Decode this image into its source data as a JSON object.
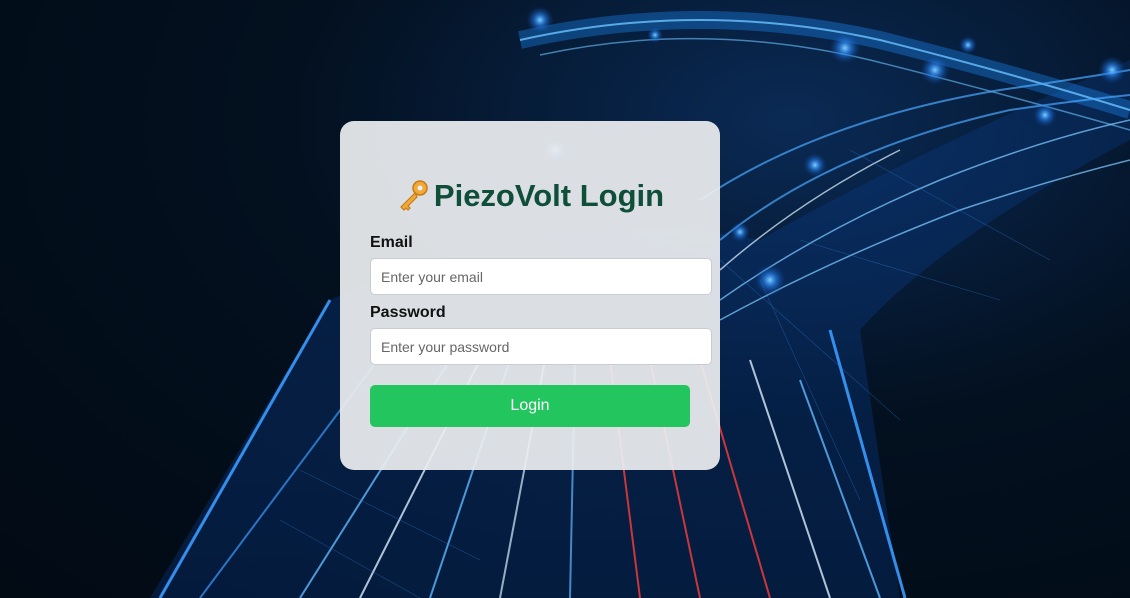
{
  "login": {
    "title": "PiezoVolt Login",
    "icon": "key-icon",
    "email_label": "Email",
    "email_placeholder": "Enter your email",
    "email_value": "",
    "password_label": "Password",
    "password_placeholder": "Enter your password",
    "password_value": "",
    "submit_label": "Login"
  },
  "colors": {
    "title": "#0f4f3a",
    "button": "#22c55e",
    "card": "#eceef0",
    "background": "#03101f",
    "highway_glow": "#1e90ff"
  }
}
